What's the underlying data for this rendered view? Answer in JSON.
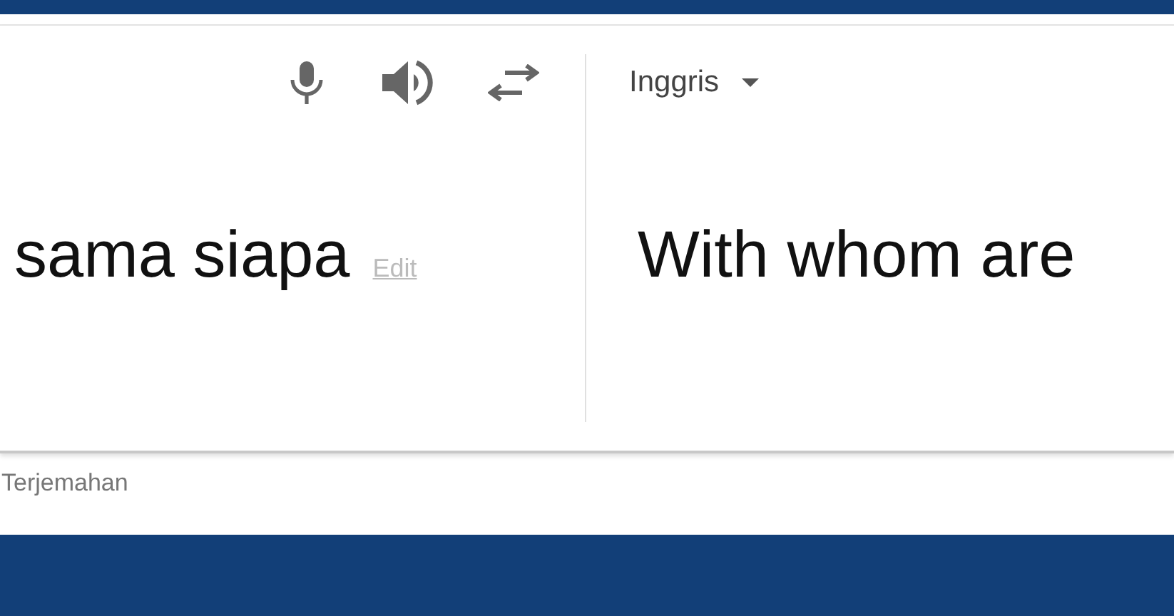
{
  "source": {
    "text": "sama siapa",
    "edit_label": "Edit"
  },
  "toolbar": {
    "tools": [
      {
        "kind": "mic"
      },
      {
        "kind": "speaker"
      },
      {
        "kind": "swap"
      }
    ]
  },
  "target": {
    "language": "Inggris",
    "text": "With whom are"
  },
  "footer": {
    "label": "Terjemahan"
  }
}
